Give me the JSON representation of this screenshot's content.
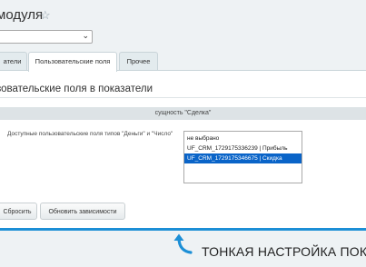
{
  "header": {
    "title": "модуля"
  },
  "tabs": [
    {
      "label": "атели",
      "active": false
    },
    {
      "label": "Пользовательские поля",
      "active": true
    },
    {
      "label": "Прочее",
      "active": false
    }
  ],
  "section": {
    "title": "зовательские поля в показатели"
  },
  "entity": {
    "header": "сущность \"Сделка\""
  },
  "field": {
    "label": "Доступные пользовательские поля типов \"Деньги\" и \"Число\"",
    "options": [
      {
        "text": "не выбрано",
        "selected": false
      },
      {
        "text": "UF_CRM_1729175336239 | Прибыль",
        "selected": false
      },
      {
        "text": "UF_CRM_1729175346675 | Скидка",
        "selected": true
      }
    ]
  },
  "buttons": {
    "reset": "Сбросить",
    "update": "Обновить зависимости"
  },
  "hint": {
    "text": "ТОНКАЯ НАСТРОЙКА ПОК"
  },
  "colors": {
    "accent": "#1c8fd6",
    "selected": "#0a64c8"
  }
}
